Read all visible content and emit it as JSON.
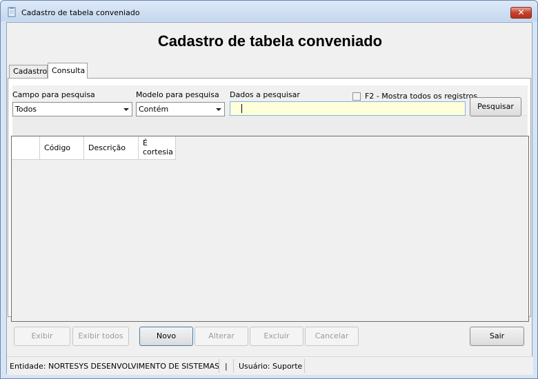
{
  "window": {
    "title": "Cadastro de tabela conveniado",
    "close_glyph": "✕",
    "title_icon": "document-icon"
  },
  "heading": "Cadastro de tabela conveniado",
  "tabs": [
    {
      "label": "Cadastro",
      "active": false
    },
    {
      "label": "Consulta",
      "active": true
    }
  ],
  "search": {
    "campo_label": "Campo para pesquisa",
    "campo_value": "Todos",
    "modelo_label": "Modelo para pesquisa",
    "modelo_value": "Contém",
    "dados_label": "Dados a pesquisar",
    "dados_value": "",
    "f2_label": "F2 - Mostra todos os registros",
    "f2_checked": false,
    "pesquisar_label": "Pesquisar"
  },
  "grid": {
    "columns": [
      {
        "key": "selector",
        "label": ""
      },
      {
        "key": "codigo",
        "label": "Código"
      },
      {
        "key": "descricao",
        "label": "Descrição"
      },
      {
        "key": "cortesia",
        "label": "É cortesia"
      }
    ],
    "rows": []
  },
  "buttons": {
    "exibir": {
      "label": "Exibir",
      "enabled": false
    },
    "exibir_todos": {
      "label": "Exibir todos",
      "enabled": false
    },
    "novo": {
      "label": "Novo",
      "enabled": true
    },
    "alterar": {
      "label": "Alterar",
      "enabled": false
    },
    "excluir": {
      "label": "Excluir",
      "enabled": false
    },
    "cancelar": {
      "label": "Cancelar",
      "enabled": false
    },
    "sair": {
      "label": "Sair",
      "enabled": true
    }
  },
  "status": {
    "entidade": "Entidade: NORTESYS DESENVOLVIMENTO DE SISTEMAS",
    "separator": "|",
    "usuario": "Usuário: Suporte"
  },
  "colors": {
    "input_bg": "#ffffd9",
    "input_border": "#7eb4ea",
    "close_button": "#c6412b"
  }
}
